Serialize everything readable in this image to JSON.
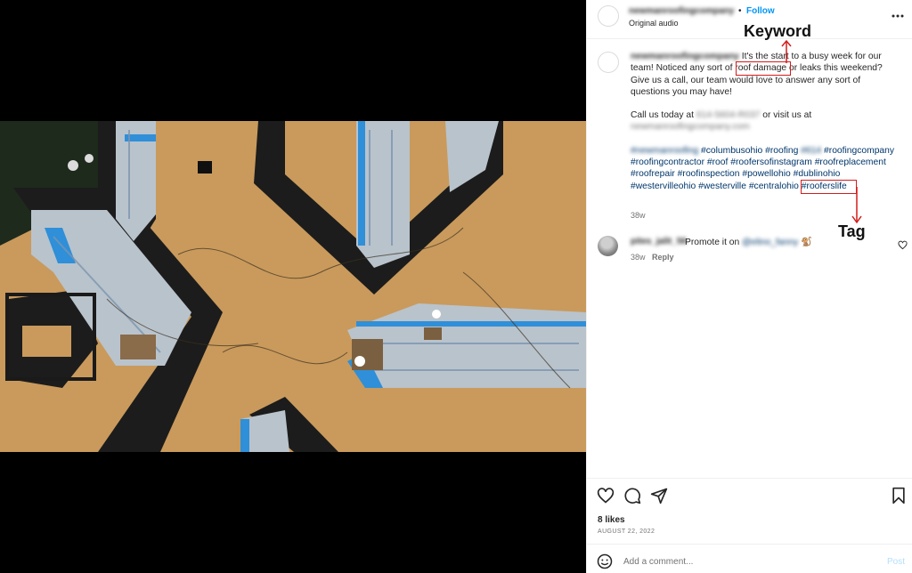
{
  "post": {
    "author": "newmanroofingcompany",
    "follow_label": "Follow",
    "dot": "•",
    "audio_label": "Original audio",
    "caption": {
      "author": "newmanroofingcompany",
      "line1_a": " It's the start to a busy week for our team! Noticed any sort of ",
      "keyword": "roof damage",
      "line1_b": " or leaks this weekend? Give us a call, our team would love to answer any sort of questions you may have!",
      "call_prefix": "Call us today at ",
      "phone": "614-5604-R037",
      "visit_text": " or visit us at ",
      "website": "newmanroofingcompany.com",
      "hashtags_before": [
        "#newmanroofing",
        "#columbusohio",
        "#roofing",
        "#614",
        "#roofingcompany",
        "#roofingcontractor",
        "#roof",
        "#roofersofinstagram",
        "#roofreplacement",
        "#roofrepair",
        "#roofinspection",
        "#powellohio",
        "#dublinohio",
        "#westervilleohio",
        "#westerville"
      ],
      "tag_highlight": "#centralohio",
      "hashtags_after": [
        "#rooferslife"
      ],
      "time": "38w"
    },
    "comment": {
      "user": "pites_jalit_56",
      "text": "Promote it on ",
      "mention": "@elino_fanny",
      "emoji": "🐒",
      "time": "38w",
      "reply_label": "Reply"
    },
    "likes": "8 likes",
    "date": "AUGUST 22, 2022",
    "add_comment_placeholder": "Add a comment...",
    "post_label": "Post"
  },
  "annotations": {
    "keyword_label": "Keyword",
    "tag_label": "Tag",
    "color": "#d41c1c"
  },
  "icons": {
    "more": "more-horizontal-icon",
    "like": "heart-icon",
    "comment": "comment-bubble-icon",
    "share": "paper-plane-icon",
    "save": "bookmark-icon",
    "emoji": "smiley-icon",
    "mute": "speaker-icon"
  }
}
